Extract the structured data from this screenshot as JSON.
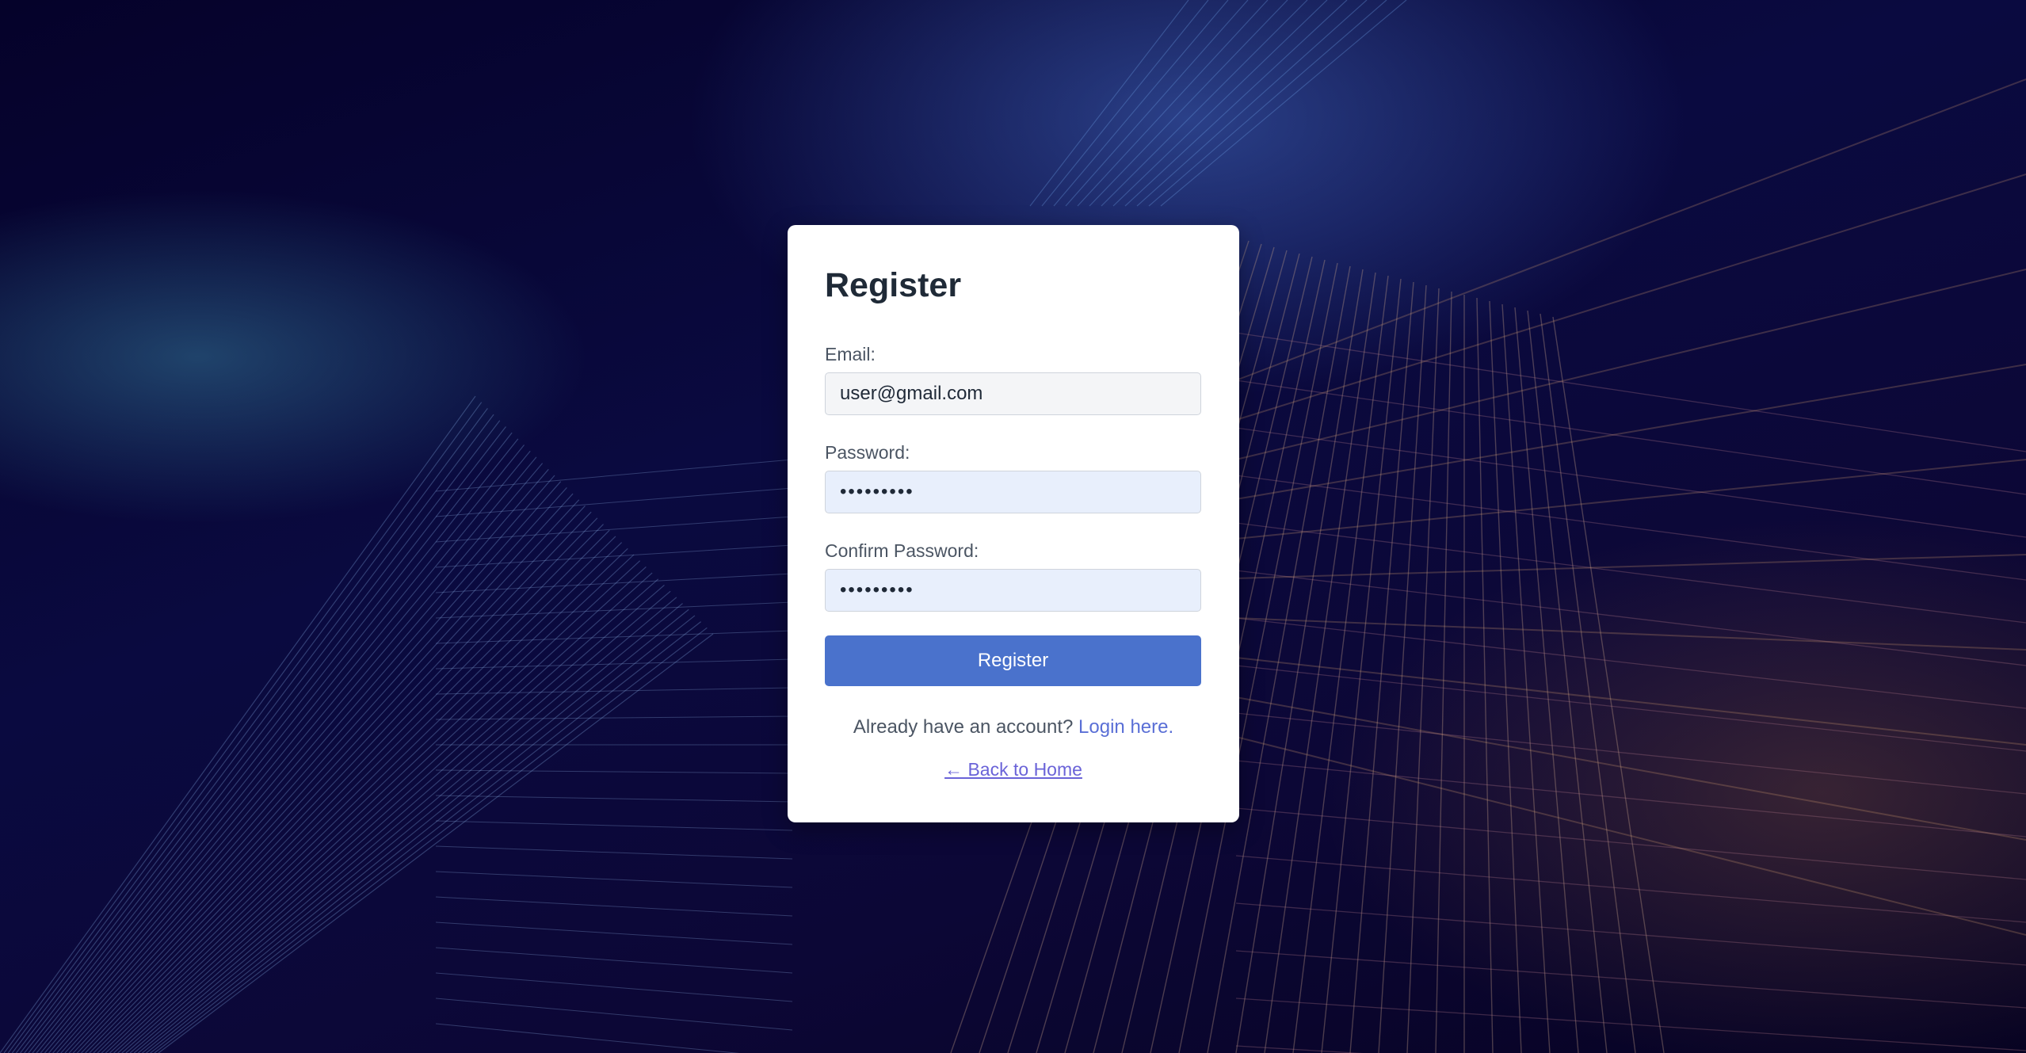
{
  "form": {
    "title": "Register",
    "email_label": "Email:",
    "email_value": "user@gmail.com",
    "password_label": "Password:",
    "password_value": "•••••••••",
    "confirm_label": "Confirm Password:",
    "confirm_value": "•••••••••",
    "submit_label": "Register",
    "login_prompt": "Already have an account?",
    "login_link": "Login here.",
    "back_link": "← Back to Home"
  },
  "colors": {
    "accent": "#4a72cc",
    "link": "#5a6fd6",
    "background": "#0a0a40"
  }
}
